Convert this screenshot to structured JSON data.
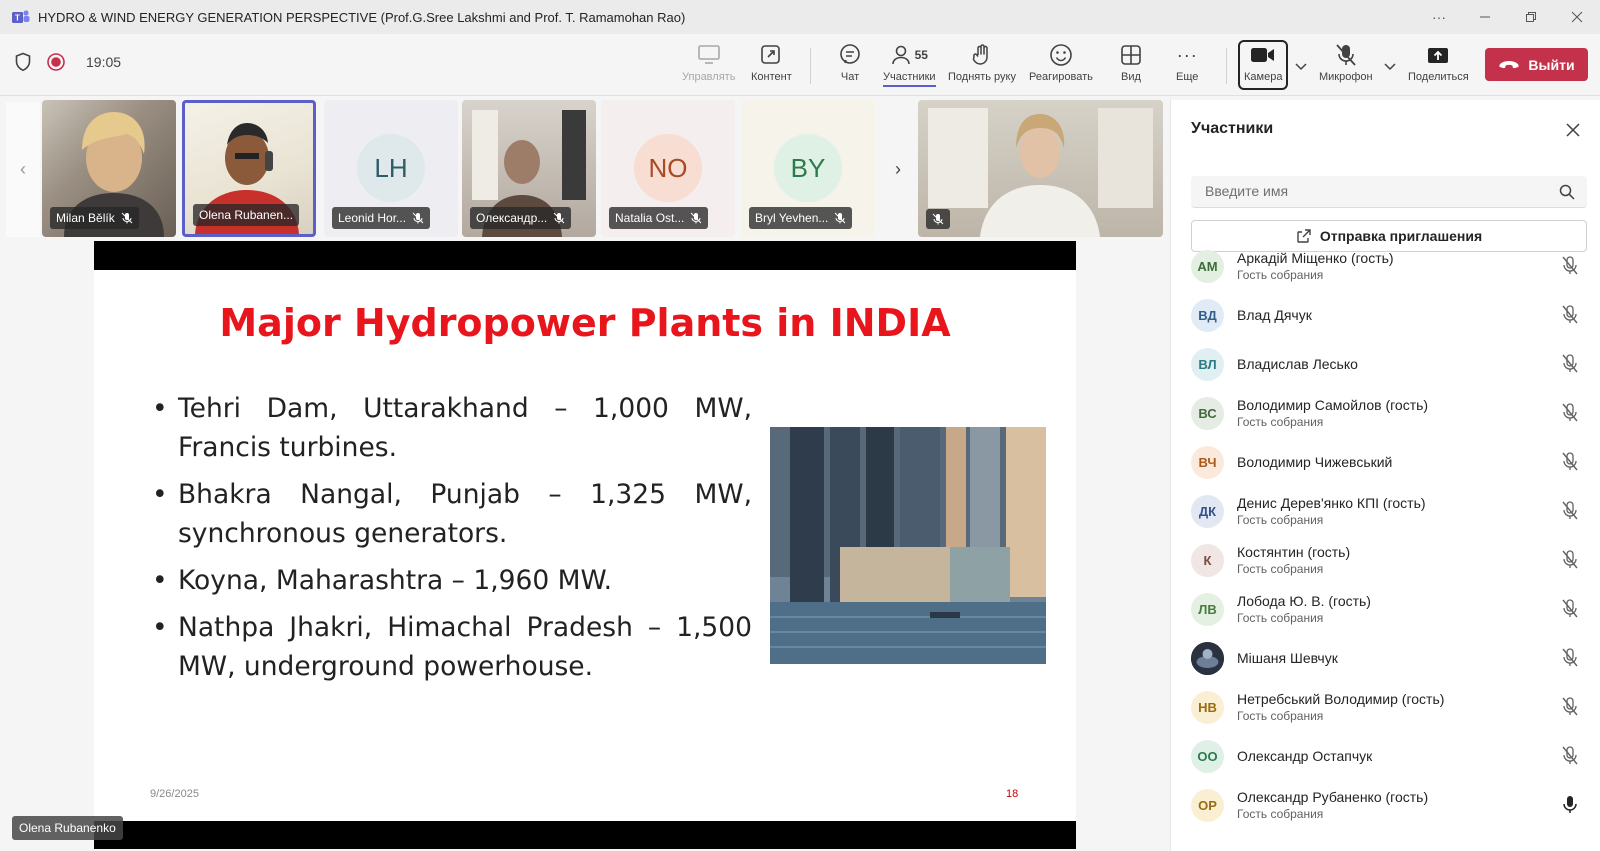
{
  "window": {
    "title": "HYDRO & WIND ENERGY GENERATION PERSPECTIVE (Prof.G.Sree Lakshmi and Prof. T. Ramamohan Rao)"
  },
  "toolbar": {
    "time": "19:05",
    "manage": "Управлять",
    "content": "Контент",
    "chat": "Чат",
    "participants": "Участники",
    "participants_count": "55",
    "raise_hand": "Поднять руку",
    "react": "Реагировать",
    "view": "Вид",
    "more": "Еще",
    "camera": "Камера",
    "mic": "Микрофон",
    "share": "Поделиться",
    "leave": "Выйти"
  },
  "video_tiles": [
    {
      "name": "Milan Bělík"
    },
    {
      "name": "Olena Rubanen..."
    },
    {
      "name": "Leonid Hor...",
      "initials": "LH"
    },
    {
      "name": "Олександр..."
    },
    {
      "name": "Natalia Ost...",
      "initials": "NO"
    },
    {
      "name": "Bryl Yevhen...",
      "initials": "BY"
    }
  ],
  "slide": {
    "title": "Major Hydropower Plants in INDIA",
    "bullets": [
      "Tehri Dam, Uttarakhand – 1,000 MW, Francis turbines.",
      "Bhakra Nangal, Punjab – 1,325 MW, synchronous generators.",
      "Koyna, Maharashtra – 1,960 MW.",
      "Nathpa Jhakri, Himachal Pradesh – 1,500 MW, underground powerhouse."
    ],
    "date": "9/26/2025",
    "page": "18"
  },
  "presenter": "Olena Rubanenko",
  "panel": {
    "title": "Участники",
    "search_placeholder": "Введите имя",
    "invite": "Отправка приглашения",
    "participants": [
      {
        "initials": "АМ",
        "name": "Аркадiй Міщенко (гость)",
        "role": "Гость собрания",
        "bg": "#e3efe1",
        "fg": "#3b6e36"
      },
      {
        "initials": "ВД",
        "name": "Влад Дячук",
        "role": "",
        "bg": "#e1ebf5",
        "fg": "#2f5f8a"
      },
      {
        "initials": "ВЛ",
        "name": "Владислав Лесько",
        "role": "",
        "bg": "#e0f0f2",
        "fg": "#2c7b84"
      },
      {
        "initials": "ВС",
        "name": "Володимир Самойлов (гость)",
        "role": "Гость собрания",
        "bg": "#e4ece3",
        "fg": "#44693e"
      },
      {
        "initials": "ВЧ",
        "name": "Володимир Чижевський",
        "role": "",
        "bg": "#fbeadb",
        "fg": "#a85b1c"
      },
      {
        "initials": "ДК",
        "name": "Денис Дерев'янко КПІ (гость)",
        "role": "Гость собрания",
        "bg": "#e1e8f4",
        "fg": "#34508a"
      },
      {
        "initials": "К",
        "name": "Костянтин (гость)",
        "role": "Гость собрания",
        "bg": "#f0e6e3",
        "fg": "#7a4a3e"
      },
      {
        "initials": "ЛВ",
        "name": "Лобода Ю. В. (гость)",
        "role": "Гость собрания",
        "bg": "#e4f0e1",
        "fg": "#4a7a40"
      },
      {
        "initials": "",
        "name": "Мішаня Шевчук",
        "role": "",
        "bg": "#2a3240",
        "fg": "#ffffff"
      },
      {
        "initials": "НВ",
        "name": "Нетребський Володимир (гость)",
        "role": "Гость собрания",
        "bg": "#fbefd3",
        "fg": "#9a6b10"
      },
      {
        "initials": "ОО",
        "name": "Олександр Остапчук",
        "role": "",
        "bg": "#dff0e6",
        "fg": "#2f7a4c"
      },
      {
        "initials": "ОР",
        "name": "Олександр Рубаненко (гость)",
        "role": "Гость собрания",
        "bg": "#fbefd3",
        "fg": "#9a6b10"
      }
    ]
  }
}
